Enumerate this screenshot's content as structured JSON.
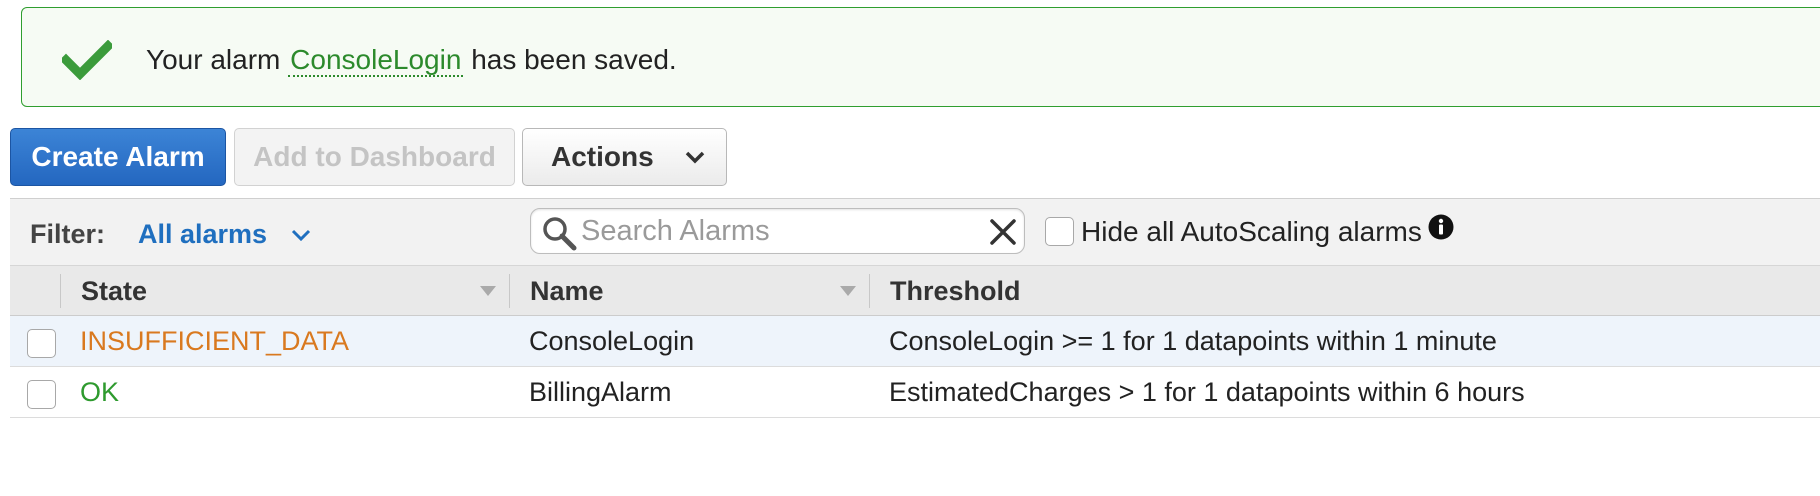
{
  "banner": {
    "prefix": "Your alarm",
    "alarm_name": "ConsoleLogin",
    "suffix": "has been saved.",
    "icon": "checkmark-icon",
    "color": "#2c8a2c"
  },
  "toolbar": {
    "create_label": "Create Alarm",
    "add_dashboard_label": "Add to Dashboard",
    "actions_label": "Actions"
  },
  "filter": {
    "label": "Filter:",
    "selected": "All alarms",
    "search_placeholder": "Search Alarms",
    "hide_autoscaling_label": "Hide all AutoScaling alarms"
  },
  "table": {
    "columns": [
      "State",
      "Name",
      "Threshold"
    ],
    "rows": [
      {
        "state": "INSUFFICIENT_DATA",
        "state_color": "#d9791f",
        "name": "ConsoleLogin",
        "threshold": "ConsoleLogin >= 1 for 1 datapoints within 1 minute"
      },
      {
        "state": "OK",
        "state_color": "#2e9a2e",
        "name": "BillingAlarm",
        "threshold": "EstimatedCharges > 1 for 1 datapoints within 6 hours"
      }
    ]
  },
  "colors": {
    "primary": "#2467c0",
    "link": "#1f6fbf",
    "success_border": "#2f9e2f"
  }
}
